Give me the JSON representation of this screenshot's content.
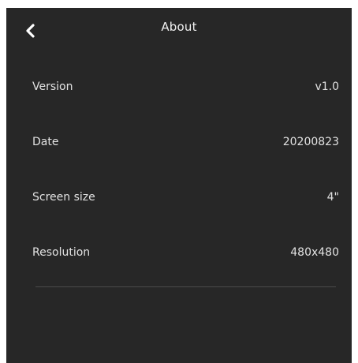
{
  "header": {
    "title": "About",
    "back_icon": "chevron-left-icon"
  },
  "info_rows": [
    {
      "label": "Version",
      "value": "v1.0"
    },
    {
      "label": "Date",
      "value": "20200823"
    },
    {
      "label": "Screen size",
      "value": "4\""
    },
    {
      "label": "Resolution",
      "value": "480x480"
    }
  ],
  "colors": {
    "background": "#272727",
    "text": "#e2e2e2",
    "divider": "#4a4a4a"
  }
}
